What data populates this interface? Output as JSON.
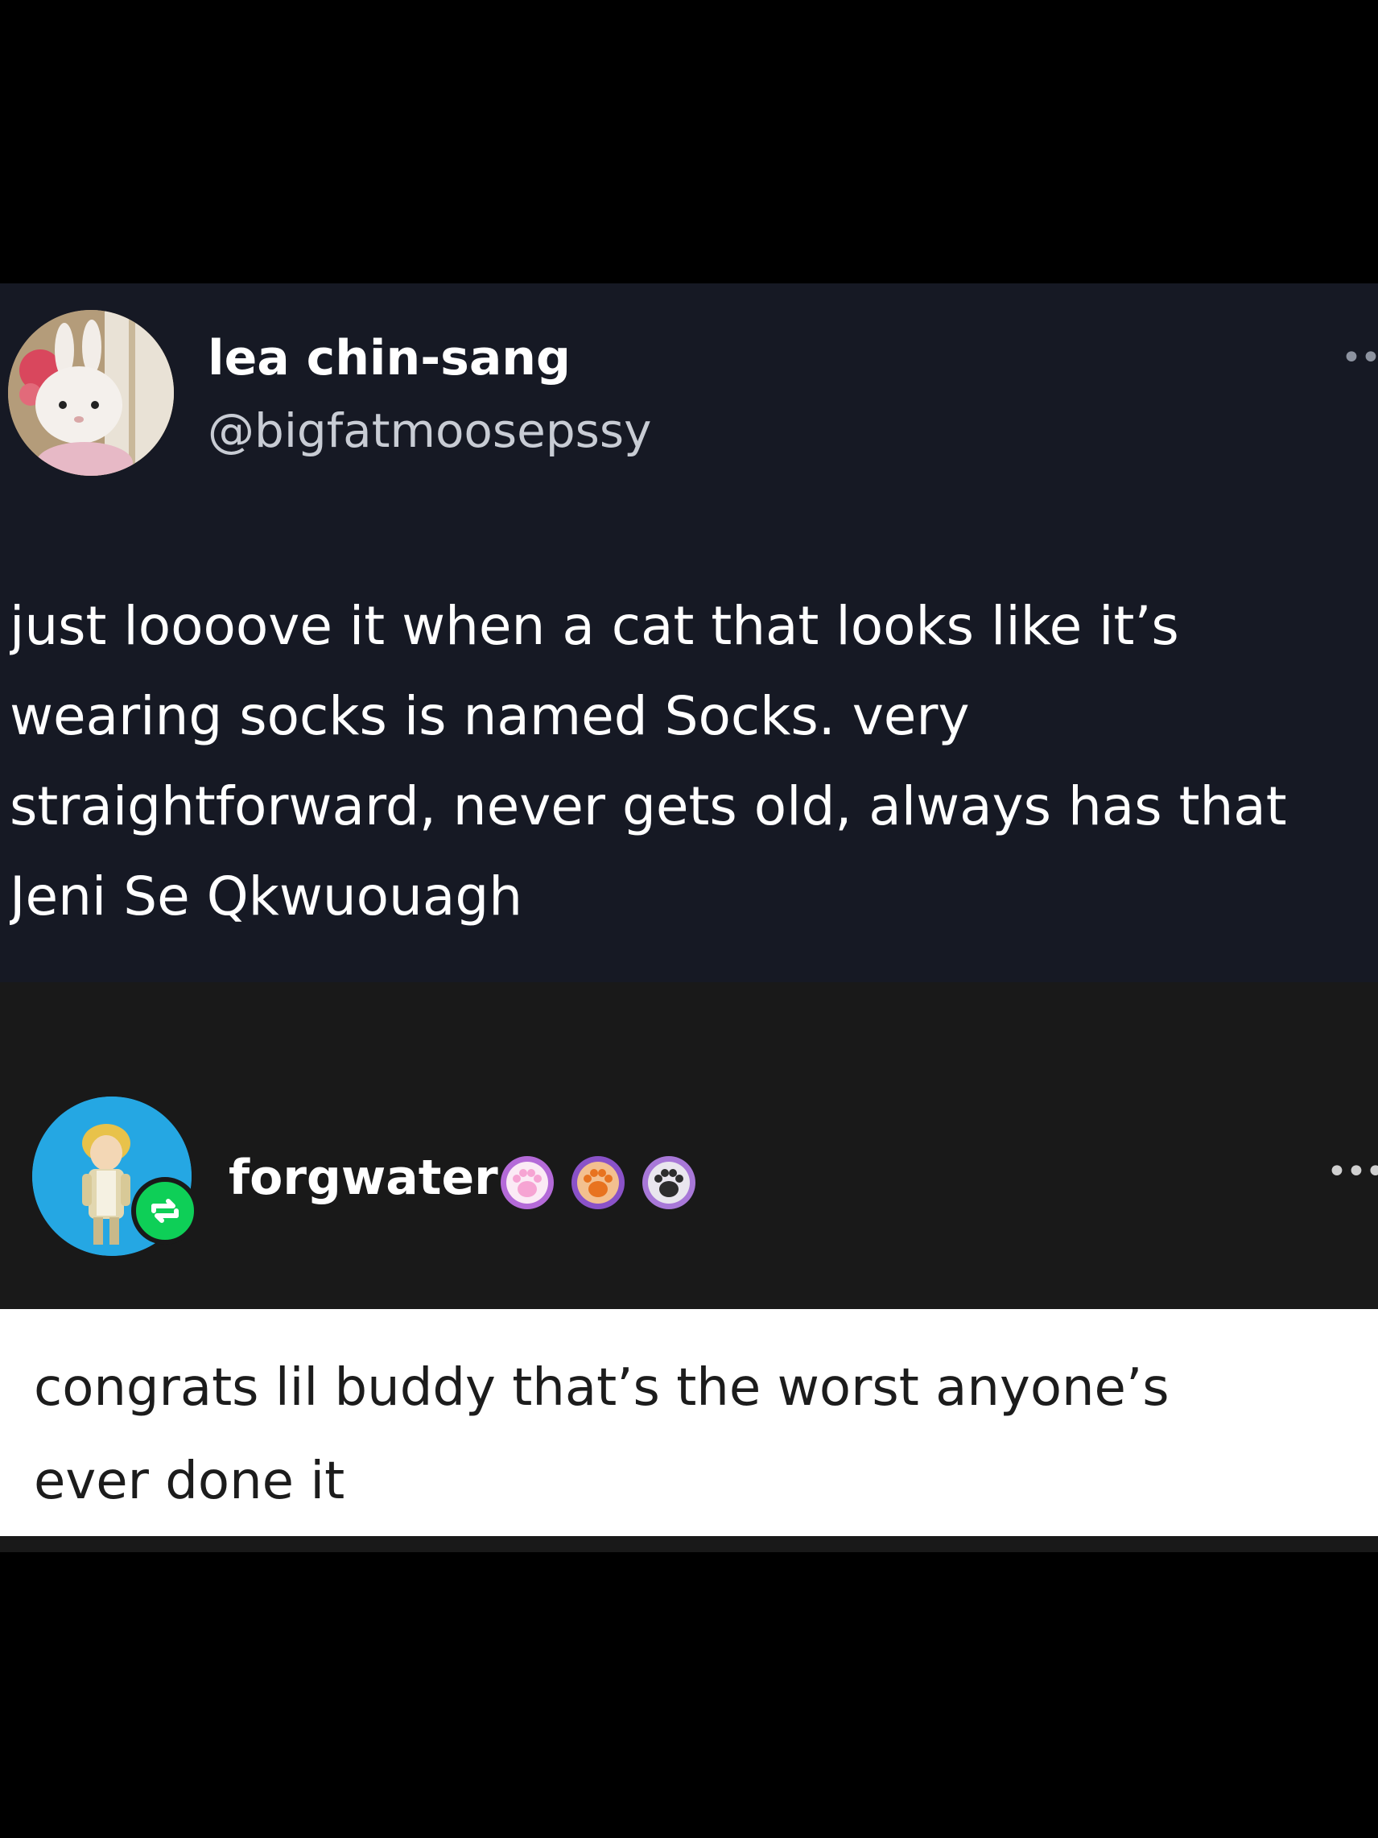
{
  "tweet": {
    "display_name": "lea chin-sang",
    "handle": "@bigfatmoosepssy",
    "more_icon": "ellipsis-icon",
    "lines": [
      "just loooove it when a cat that looks like it’s",
      "wearing socks is named Socks. very",
      "straightforward, never gets old, always has that",
      "Jeni Se Qkwuouagh"
    ]
  },
  "reblog": {
    "username": "forgwater",
    "reblog_icon": "reblog-icon",
    "more_icon": "ellipsis-icon",
    "badges": [
      {
        "icon": "paw-badge-icon",
        "color": "#f6a4d3",
        "ring": "#b46ad8"
      },
      {
        "icon": "paw-badge-icon",
        "color": "#e8731f",
        "ring": "#8a52c8"
      },
      {
        "icon": "paw-badge-icon",
        "color": "#2d2d2d",
        "ring": "#a878d8"
      }
    ]
  },
  "reply": {
    "lines": [
      "congrats lil buddy that’s the worst anyone’s",
      "ever done it"
    ]
  },
  "colors": {
    "tweet_background": "#161924",
    "reblog_header_background": "#191919",
    "reply_background": "#ffffff",
    "reblog_badge_green": "#0ecf57",
    "avatar_blue": "#25a7e3"
  }
}
